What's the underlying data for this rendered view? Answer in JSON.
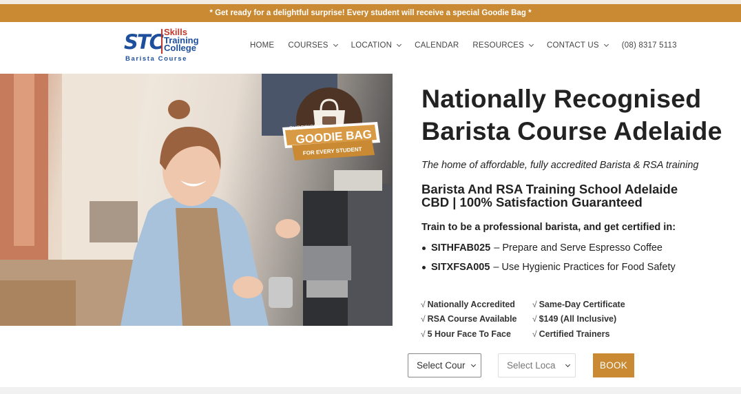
{
  "announcement": "* Get ready for a delightful surprise! Every student will receive a special Goodie Bag *",
  "logo": {
    "mark": "STC",
    "words": [
      "Skills",
      "Training",
      "College"
    ],
    "subtitle": "Barista Course"
  },
  "nav": {
    "items": [
      {
        "label": "HOME",
        "dropdown": false
      },
      {
        "label": "COURSES",
        "dropdown": true
      },
      {
        "label": "LOCATION",
        "dropdown": true
      },
      {
        "label": "CALENDAR",
        "dropdown": false
      },
      {
        "label": "RESOURCES",
        "dropdown": true
      },
      {
        "label": "CONTACT US",
        "dropdown": true
      },
      {
        "label": "(08) 8317 5113",
        "dropdown": false
      }
    ]
  },
  "hero": {
    "badge_line1": "SURPRISE",
    "badge_title": "GOODIE BAG",
    "badge_line2": "FOR EVERY STUDENT"
  },
  "content": {
    "title_line1": "Nationally Recognised",
    "title_line2": "Barista Course Adelaide",
    "tagline": "The home of affordable, fully accredited Barista & RSA training",
    "subheading_line1": "Barista And RSA Training School Adelaide",
    "subheading_line2": "CBD | 100% Satisfaction Guaranteed",
    "train_intro": "Train to be a professional barista, and get certified in:",
    "units": [
      {
        "code": "SITHFAB025",
        "desc": "– Prepare and Serve Espresso Coffee"
      },
      {
        "code": "SITXFSA005",
        "desc": "– Use Hygienic Practices for Food Safety"
      }
    ]
  },
  "features": {
    "tick": "√",
    "rows": [
      [
        "Nationally Accredited",
        "Same-Day Certificate"
      ],
      [
        "RSA Course Available",
        "$149 (All Inclusive)"
      ],
      [
        "5 Hour Face To Face",
        "Certified Trainers"
      ]
    ]
  },
  "controls": {
    "course_select": "Select Cour",
    "location_select": "Select Loca",
    "book_label": "BOOK"
  },
  "colors": {
    "accent": "#c98a33",
    "brand_blue": "#1e4f9c",
    "brand_red": "#c0392b"
  }
}
